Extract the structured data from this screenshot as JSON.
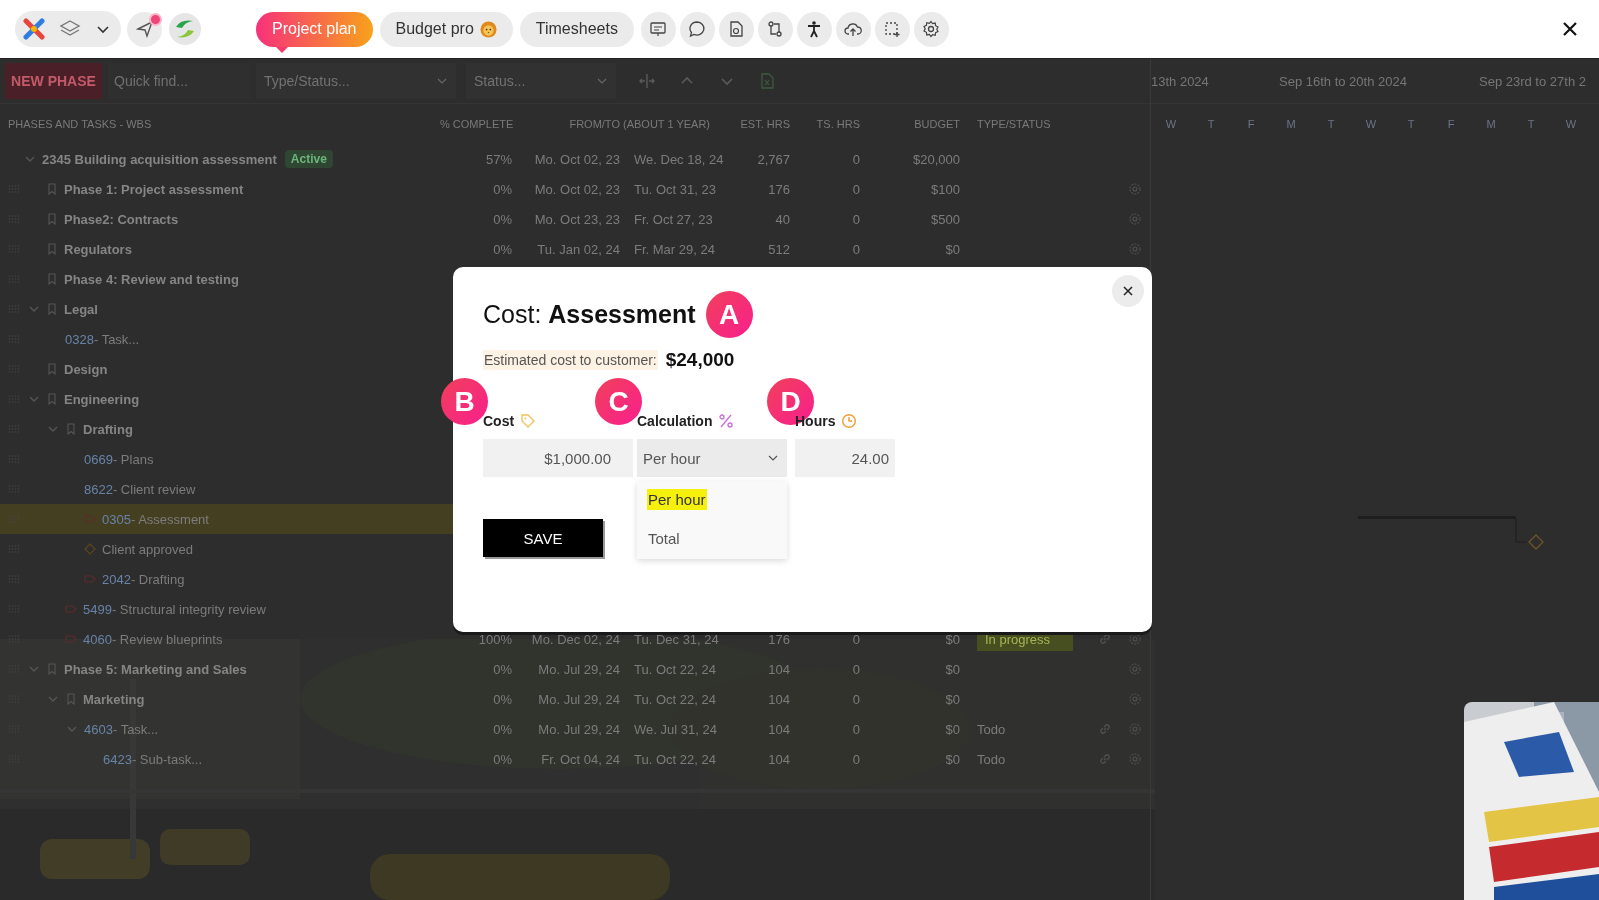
{
  "topbar": {
    "tabs": [
      {
        "label": "Project plan",
        "selected": true
      },
      {
        "label": "Budget pro",
        "selected": false
      },
      {
        "label": "Timesheets",
        "selected": false
      }
    ]
  },
  "toolbar": {
    "new_button": "NEW PHASE",
    "search_placeholder": "Quick find...",
    "filters": [
      {
        "placeholder": "Type/Status..."
      },
      {
        "placeholder": "Status..."
      }
    ]
  },
  "table": {
    "columns": [
      "PHASES AND TASKS - WBS",
      "% COMPLETE",
      "FROM/TO (ABOUT 1 YEAR)",
      "EST. HRS",
      "TS. HRS",
      "BUDGET",
      "TYPE/STATUS"
    ],
    "rows": [
      {
        "kind": "root",
        "name": "2345 Building acquisition assessment",
        "badge": "Active",
        "expanded": true,
        "selected": false,
        "percent": "57%",
        "from": "Mo. Oct 02, 23",
        "to": "We. Dec 18, 24",
        "est_hrs": "2,767",
        "ts_hrs": "0",
        "budget": "$20,000",
        "children": [
          {
            "kind": "phase",
            "name": "Phase 1: Project assessment",
            "selected": false,
            "percent": "0%",
            "from": "Mo. Oct 02, 23",
            "to": "Tu. Oct 31, 23",
            "est_hrs": "176",
            "ts_hrs": "0",
            "budget": "$100"
          },
          {
            "kind": "phase",
            "name": "Phase2: Contracts",
            "selected": false,
            "percent": "0%",
            "from": "Mo. Oct 23, 23",
            "to": "Fr. Oct 27, 23",
            "est_hrs": "40",
            "ts_hrs": "0",
            "budget": "$500"
          },
          {
            "kind": "phase",
            "name": "Regulators",
            "selected": false,
            "percent": "0%",
            "from": "Tu. Jan 02, 24",
            "to": "Fr. Mar 29, 24",
            "est_hrs": "512",
            "ts_hrs": "0",
            "budget": "$0"
          },
          {
            "kind": "phase",
            "name": "Phase 4: Review and testing",
            "selected": false
          },
          {
            "kind": "phase",
            "name": "Legal",
            "expanded": true,
            "selected": false,
            "children": [
              {
                "kind": "task",
                "code": "0328",
                "name": "- Task...",
                "selected": false
              }
            ]
          },
          {
            "kind": "phase",
            "name": "Design",
            "selected": false
          },
          {
            "kind": "phase",
            "name": "Engineering",
            "expanded": true,
            "selected": false,
            "children": [
              {
                "kind": "phase",
                "name": "Drafting",
                "expanded": true,
                "selected": false,
                "children": [
                  {
                    "kind": "task",
                    "code": "0669",
                    "name": "- Plans",
                    "selected": false
                  },
                  {
                    "kind": "task",
                    "code": "8622",
                    "name": "- Client review",
                    "selected": false
                  },
                  {
                    "kind": "flagged",
                    "code": "0305",
                    "name": "- Assessment",
                    "selected": true
                  },
                  {
                    "kind": "milestone",
                    "name": "Client approved",
                    "selected": false
                  },
                  {
                    "kind": "flagged",
                    "code": "2042",
                    "name": "- Drafting",
                    "selected": false
                  }
                ]
              },
              {
                "kind": "flagged",
                "code": "5499",
                "name": "- Structural integrity review",
                "selected": false
              },
              {
                "kind": "flagged",
                "code": "4060",
                "name": "- Review blueprints",
                "selected": false,
                "percent": "100%",
                "from": "Mo. Dec 02, 24",
                "to": "Tu. Dec 31, 24",
                "est_hrs": "176",
                "ts_hrs": "0",
                "budget": "$0",
                "status": {
                  "label": "In progress",
                  "kind": "progress"
                },
                "linked": true
              }
            ]
          },
          {
            "kind": "phase",
            "name": "Phase 5: Marketing and Sales",
            "expanded": true,
            "selected": false,
            "percent": "0%",
            "from": "Mo. Jul 29, 24",
            "to": "Tu. Oct 22, 24",
            "est_hrs": "104",
            "ts_hrs": "0",
            "budget": "$0",
            "children": [
              {
                "kind": "phase",
                "name": "Marketing",
                "expanded": true,
                "selected": false,
                "percent": "0%",
                "from": "Mo. Jul 29, 24",
                "to": "Tu. Oct 22, 24",
                "est_hrs": "104",
                "ts_hrs": "0",
                "budget": "$0",
                "children": [
                  {
                    "kind": "task",
                    "code": "4603",
                    "name": "- Task...",
                    "expanded": true,
                    "selected": false,
                    "percent": "0%",
                    "from": "Mo. Jul 29, 24",
                    "to": "We. Jul 31, 24",
                    "est_hrs": "104",
                    "ts_hrs": "0",
                    "budget": "$0",
                    "status": {
                      "label": "Todo",
                      "kind": "plain"
                    },
                    "linked": true,
                    "children": [
                      {
                        "kind": "task",
                        "code": "6423",
                        "name": "- Sub-task...",
                        "selected": false,
                        "percent": "0%",
                        "from": "Fr. Oct 04, 24",
                        "to": "Tu. Oct 22, 24",
                        "est_hrs": "104",
                        "ts_hrs": "0",
                        "budget": "$0",
                        "status": {
                          "label": "Todo",
                          "kind": "plain"
                        },
                        "linked": true
                      }
                    ]
                  }
                ]
              }
            ]
          }
        ]
      }
    ]
  },
  "gantt": {
    "weeks": [
      "13th 2024",
      "Sep 16th to 20th 2024",
      "Sep 23rd to 27th 2"
    ],
    "days": [
      "W",
      "T",
      "F",
      "M",
      "T",
      "W",
      "T",
      "F",
      "M",
      "T",
      "W"
    ]
  },
  "dialog": {
    "title": "Cost: **Assessment**",
    "title_marker": "A",
    "estimate_label": "Estimated cost to customer:",
    "estimate_value": "$24,000",
    "fields": [
      {
        "kind": "input",
        "label": "Cost",
        "marker": "B",
        "value": "$1,000.00"
      },
      {
        "kind": "select",
        "label": "Calculation",
        "marker": "C",
        "value": "Per hour",
        "options": [
          {
            "label": "Per hour",
            "selected": true
          },
          {
            "label": "Total",
            "selected": false
          }
        ]
      },
      {
        "kind": "input",
        "label": "Hours",
        "marker": "D",
        "value": "24.00"
      }
    ],
    "save": "SAVE"
  }
}
